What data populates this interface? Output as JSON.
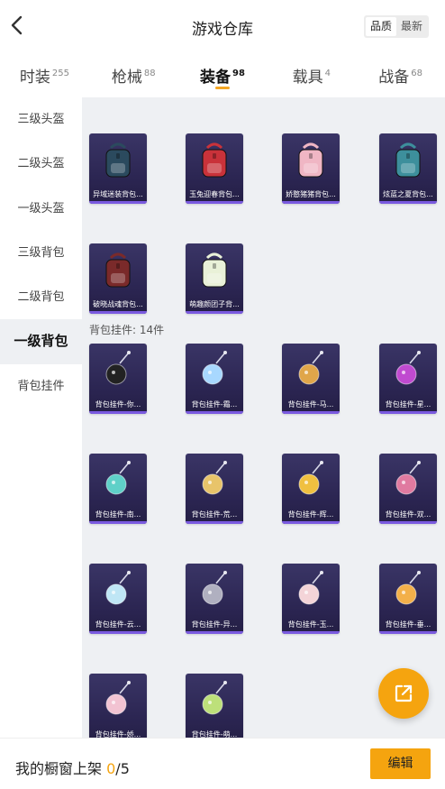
{
  "header": {
    "title": "游戏仓库",
    "sort_options": [
      "品质",
      "最新"
    ],
    "active_sort": "品质"
  },
  "tabs": [
    {
      "label": "时装",
      "count": "255"
    },
    {
      "label": "枪械",
      "count": "88"
    },
    {
      "label": "装备",
      "count": "98",
      "active": true
    },
    {
      "label": "载具",
      "count": "4"
    },
    {
      "label": "战备",
      "count": "68"
    }
  ],
  "sidebar": {
    "items": [
      {
        "label": "三级头盔"
      },
      {
        "label": "二级头盔"
      },
      {
        "label": "一级头盔"
      },
      {
        "label": "三级背包"
      },
      {
        "label": "二级背包"
      },
      {
        "label": "一级背包",
        "active": true
      },
      {
        "label": "背包挂件"
      }
    ]
  },
  "backpacks": [
    {
      "name": "异域迷装背包...",
      "icon": "backpack-icon",
      "color": "#2b4a5e"
    },
    {
      "name": "玉兔迎春背包...",
      "icon": "backpack-icon",
      "color": "#c9323a"
    },
    {
      "name": "娇憨猪猪背包...",
      "icon": "backpack-icon",
      "color": "#f0b6c4"
    },
    {
      "name": "炫蓝之夏背包...",
      "icon": "backpack-icon",
      "color": "#3d8f9c"
    },
    {
      "name": "破晓战魂背包...",
      "icon": "backpack-icon",
      "color": "#7a2a2a"
    },
    {
      "name": "萌趣颜团子背...",
      "icon": "backpack-icon",
      "color": "#e9f1d8"
    }
  ],
  "pendants_section": {
    "label": "背包挂件: 14件"
  },
  "pendants": [
    {
      "name": "背包挂件-你...",
      "icon": "penguin-charm-icon",
      "color": "#222222"
    },
    {
      "name": "背包挂件-霜...",
      "icon": "crystal-charm-icon",
      "color": "#a8d8ff"
    },
    {
      "name": "背包挂件-马...",
      "icon": "horse-charm-icon",
      "color": "#e0a64a"
    },
    {
      "name": "背包挂件-星...",
      "icon": "planet-charm-icon",
      "color": "#c04ad0"
    },
    {
      "name": "背包挂件-南...",
      "icon": "sword-charm-icon",
      "color": "#5fd0c8"
    },
    {
      "name": "背包挂件-荒...",
      "icon": "star-charm-icon",
      "color": "#e8c46a"
    },
    {
      "name": "背包挂件-辉...",
      "icon": "feather-charm-icon",
      "color": "#f0c040"
    },
    {
      "name": "背包挂件-双...",
      "icon": "blade-charm-icon",
      "color": "#e07aa0"
    },
    {
      "name": "背包挂件-云...",
      "icon": "cloud-charm-icon",
      "color": "#bfe6f5"
    },
    {
      "name": "背包挂件-异...",
      "icon": "wings-charm-icon",
      "color": "#b0b0c0"
    },
    {
      "name": "背包挂件-玉...",
      "icon": "rabbit-charm-icon",
      "color": "#f4d4d8"
    },
    {
      "name": "背包挂件-垂...",
      "icon": "cat-charm-icon",
      "color": "#f3b04a"
    },
    {
      "name": "背包挂件-娇...",
      "icon": "pig-charm-icon",
      "color": "#f2c3d2"
    },
    {
      "name": "背包挂件-萌...",
      "icon": "dumpling-charm-icon",
      "color": "#bde07a"
    }
  ],
  "footer": {
    "shelf_label": "我的橱窗上架",
    "shelf_current": "0",
    "shelf_total": "/5",
    "edit_label": "编辑"
  },
  "colors": {
    "accent": "#f5a40f",
    "card_bg": "#2a2450",
    "rarity_bar": "#7a5ae0"
  }
}
